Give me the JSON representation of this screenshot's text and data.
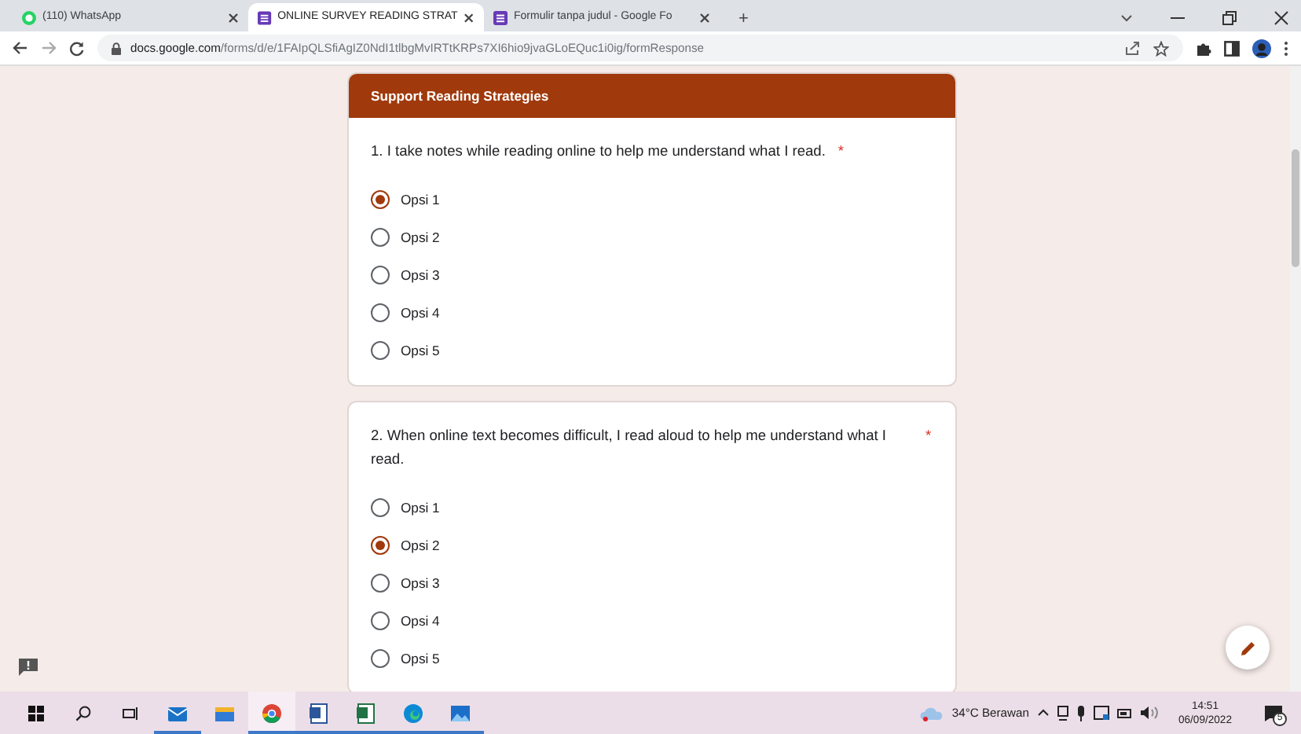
{
  "browser": {
    "tabs": [
      {
        "kind": "whatsapp",
        "title": "(110) WhatsApp",
        "selected": false
      },
      {
        "kind": "forms",
        "title": "ONLINE SURVEY READING STRAT",
        "selected": true
      },
      {
        "kind": "forms",
        "title": "Formulir tanpa judul - Google Fo",
        "selected": false
      }
    ],
    "new_tab": "+",
    "url_host": "docs.google.com",
    "url_path": "/forms/d/e/1FAIpQLSfiAgIZ0NdI1tlbgMvIRTtKRPs7XI6hio9jvaGLoEQuc1i0ig/formResponse"
  },
  "form": {
    "section_title": "Support Reading Strategies",
    "questions": [
      {
        "text": "1.  I take notes while reading online to help me understand what I read.",
        "required_mark": "*",
        "options": [
          {
            "label": "Opsi 1",
            "selected": true
          },
          {
            "label": "Opsi 2",
            "selected": false
          },
          {
            "label": "Opsi 3",
            "selected": false
          },
          {
            "label": "Opsi 4",
            "selected": false
          },
          {
            "label": "Opsi 5",
            "selected": false
          }
        ]
      },
      {
        "text": "2.  When online text becomes difficult, I read aloud to help me understand what I read.",
        "required_mark": "*",
        "options": [
          {
            "label": "Opsi 1",
            "selected": false
          },
          {
            "label": "Opsi 2",
            "selected": true
          },
          {
            "label": "Opsi 3",
            "selected": false
          },
          {
            "label": "Opsi 4",
            "selected": false
          },
          {
            "label": "Opsi 5",
            "selected": false
          }
        ]
      }
    ]
  },
  "taskbar": {
    "apps": [
      {
        "kind": "mail",
        "open": true,
        "selected": false
      },
      {
        "kind": "files",
        "open": false,
        "selected": false
      },
      {
        "kind": "chrome",
        "open": true,
        "selected": true
      },
      {
        "kind": "word",
        "open": true,
        "selected": false
      },
      {
        "kind": "excel",
        "open": true,
        "selected": false
      },
      {
        "kind": "edge",
        "open": true,
        "selected": false
      },
      {
        "kind": "photos",
        "open": true,
        "selected": false
      }
    ],
    "weather": "34°C Berawan",
    "time": "14:51",
    "date": "06/09/2022",
    "notifications": "5"
  }
}
